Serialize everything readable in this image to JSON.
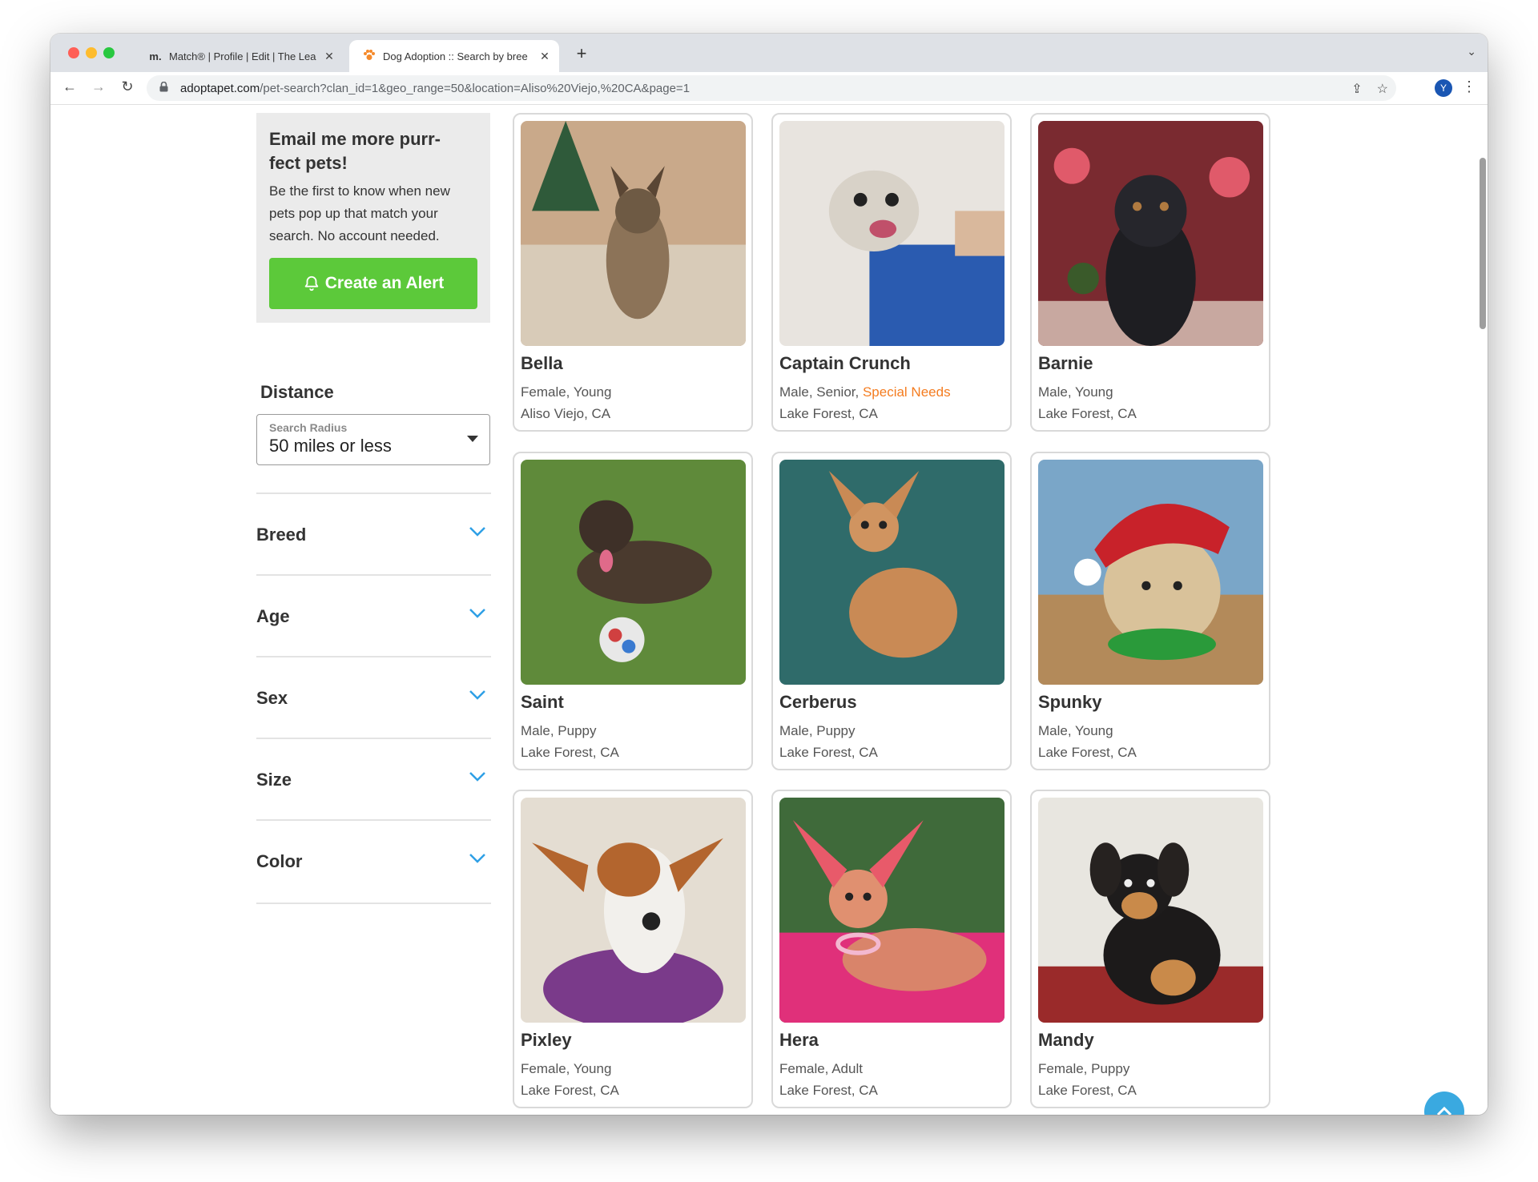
{
  "browser": {
    "tabs": [
      {
        "favicon": "m.",
        "title": "Match® | Profile | Edit | The Lea"
      },
      {
        "favicon": "paw-icon",
        "title": "Dog Adoption :: Search by bree"
      }
    ],
    "url_domain": "adoptapet.com",
    "url_path": "/pet-search?clan_id=1&geo_range=50&location=Aliso%20Viejo,%20CA&page=1",
    "profile_initial": "Y"
  },
  "alert_box": {
    "title": "Email me more purr-fect pets!",
    "text": "Be the first to know when new pets pop up that match your search. No account needed.",
    "button": "Create an Alert"
  },
  "distance": {
    "label": "Distance",
    "caption": "Search Radius",
    "value": "50 miles or less"
  },
  "filters": [
    "Breed",
    "Age",
    "Sex",
    "Size",
    "Color"
  ],
  "pets": [
    {
      "name": "Bella",
      "info": "Female, Young",
      "special": "",
      "location": "Aliso Viejo, CA"
    },
    {
      "name": "Captain Crunch",
      "info": "Male, Senior, ",
      "special": "Special Needs",
      "location": "Lake Forest, CA"
    },
    {
      "name": "Barnie",
      "info": "Male, Young",
      "special": "",
      "location": "Lake Forest, CA"
    },
    {
      "name": "Saint",
      "info": "Male, Puppy",
      "special": "",
      "location": "Lake Forest, CA"
    },
    {
      "name": "Cerberus",
      "info": "Male, Puppy",
      "special": "",
      "location": "Lake Forest, CA"
    },
    {
      "name": "Spunky",
      "info": "Male, Young",
      "special": "",
      "location": "Lake Forest, CA"
    },
    {
      "name": "Pixley",
      "info": "Female, Young",
      "special": "",
      "location": "Lake Forest, CA"
    },
    {
      "name": "Hera",
      "info": "Female, Adult",
      "special": "",
      "location": "Lake Forest, CA"
    },
    {
      "name": "Mandy",
      "info": "Female, Puppy",
      "special": "",
      "location": "Lake Forest, CA"
    }
  ],
  "colors": {
    "alert_button": "#5cc93a",
    "special_needs": "#f47c20",
    "chevron": "#2e9fe6",
    "scroll_top": "#3aa9e0"
  }
}
